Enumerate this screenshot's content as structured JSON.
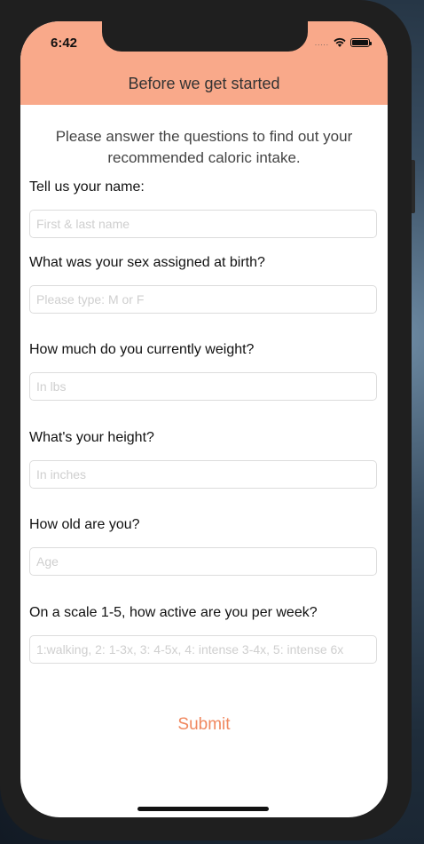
{
  "status_bar": {
    "time": "6:42",
    "signal": "....."
  },
  "nav": {
    "title": "Before we get started"
  },
  "intro": "Please answer the questions to find out your recommended caloric intake.",
  "questions": [
    {
      "label": "Tell us your name:",
      "placeholder": "First & last name"
    },
    {
      "label": "What was your sex assigned at birth?",
      "placeholder": "Please type: M or F"
    },
    {
      "label": "How much do you currently weight?",
      "placeholder": "In lbs"
    },
    {
      "label": "What's your height?",
      "placeholder": "In inches"
    },
    {
      "label": "How old are you?",
      "placeholder": "Age"
    },
    {
      "label": "On a scale 1-5, how active are you per week?",
      "placeholder": "1:walking, 2: 1-3x, 3: 4-5x, 4: intense 3-4x, 5: intense 6x"
    }
  ],
  "submit_label": "Submit",
  "colors": {
    "accent": "#f9a98a",
    "submit_text": "#f0885f"
  }
}
